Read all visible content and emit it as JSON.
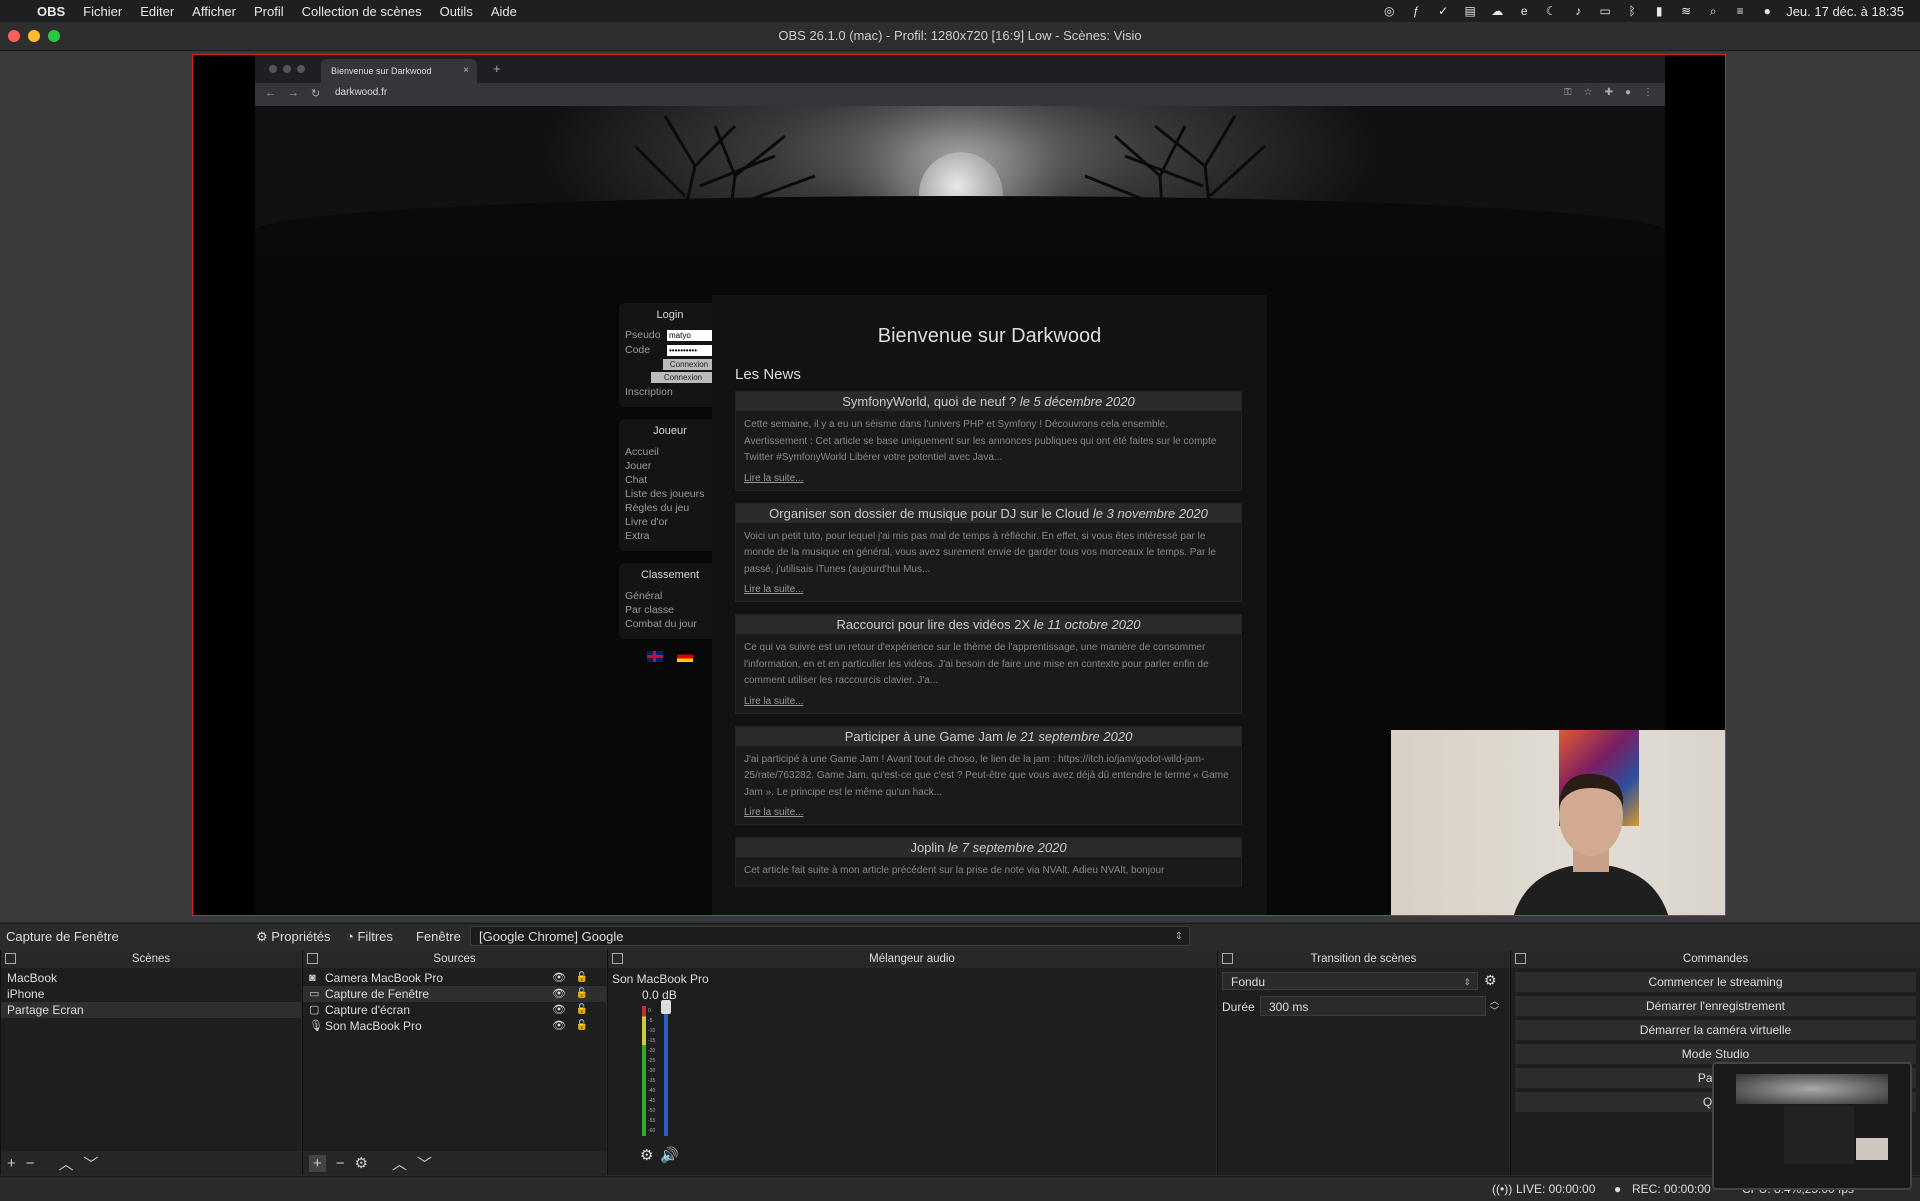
{
  "menubar": {
    "app": "OBS",
    "items": [
      "Fichier",
      "Editer",
      "Afficher",
      "Profil",
      "Collection de scènes",
      "Outils",
      "Aide"
    ],
    "clock": "Jeu. 17 déc. à 18:35",
    "status_icons": [
      "obs-status-icon",
      "text-icon",
      "checkmark-icon",
      "docker-icon",
      "cloud-icon",
      "edge-icon",
      "moon-icon",
      "volume-icon",
      "keyboard-icon",
      "bluetooth-icon",
      "battery-icon",
      "wifi-icon",
      "search-icon",
      "control-center-icon",
      "siri-icon"
    ]
  },
  "window": {
    "title": "OBS 26.1.0 (mac) - Profil: 1280x720 [16:9] Low - Scènes: Visio",
    "light_colors": [
      "#ff5f57",
      "#febc2e",
      "#28c840"
    ]
  },
  "preview": {
    "browser": {
      "tab_title": "Bienvenue sur Darkwood",
      "url": "darkwood.fr"
    },
    "site": {
      "login": {
        "title": "Login",
        "pseudo_label": "Pseudo",
        "pseudo_value": "matyo",
        "code_label": "Code",
        "code_value": "••••••••••",
        "connexion_btn": "Connexion",
        "fb_connexion_btn": "Connexion",
        "inscription": "Inscription"
      },
      "joueur": {
        "title": "Joueur",
        "links": [
          "Accueil",
          "Jouer",
          "Chat",
          "Liste des joueurs",
          "Règles du jeu",
          "Livre d'or",
          "Extra"
        ]
      },
      "classement": {
        "title": "Classement",
        "links": [
          "Général",
          "Par classe",
          "Combat du jour"
        ]
      },
      "welcome": "Bienvenue sur Darkwood",
      "news_heading": "Les News",
      "news": [
        {
          "title": "SymfonyWorld, quoi de neuf ?",
          "date": "le 5 décembre 2020",
          "body": "Cette semaine, il y a eu un séisme dans l'univers PHP et Symfony ! Découvrons cela ensemble. Avertissement : Cet article se base uniquement sur les annonces publiques qui ont été faites sur le compte Twitter #SymfonyWorld Libérer votre potentiel avec Java...",
          "more": "Lire la suite..."
        },
        {
          "title": "Organiser son dossier de musique pour DJ sur le Cloud",
          "date": "le 3 novembre 2020",
          "body": "Voici un petit tuto, pour lequel j'ai mis pas mal de temps à réfléchir. En effet, si vous êtes intéressé par le monde de la musique en général, vous avez surement envie de garder tous vos morceaux le temps. Par le passé, j'utilisais iTunes (aujourd'hui Mus...",
          "more": "Lire la suite..."
        },
        {
          "title": "Raccourci pour lire des vidéos 2X",
          "date": "le 11 octobre 2020",
          "body": "Ce qui va suivre est un retour d'expérience sur le thème de l'apprentissage, une manière de consommer l'information, en et en particulier les vidéos. J'ai besoin de faire une mise en contexte pour parler enfin de comment utiliser les raccourcis clavier. J'a...",
          "more": "Lire la suite..."
        },
        {
          "title": "Participer à une Game Jam",
          "date": "le 21 septembre 2020",
          "body": "J'ai participé à une Game Jam ! Avant tout de choso, le lien de la jam : https://itch.io/jam/godot-wild-jam-25/rate/763282. Game Jam, qu'est-ce que c'est ? Peut-être que vous avez déjà dû entendre le terme « Game Jam ». Le principe est le même qu'un hack...",
          "more": "Lire la suite..."
        },
        {
          "title": "Joplin",
          "date": "le 7 septembre 2020",
          "body": "Cet article fait suite à mon article précédent sur la prise de note via NVAlt. Adieu NVAlt, bonjour",
          "more": ""
        }
      ]
    }
  },
  "sourcebar": {
    "selected_source": "Capture de Fenêtre",
    "properties": "Propriétés",
    "filters": "Filtres",
    "window_label": "Fenêtre",
    "window_value": "[Google Chrome] Google"
  },
  "docks": {
    "scenes": {
      "title": "Scènes",
      "items": [
        "MacBook",
        "iPhone",
        "Partage Ecran"
      ],
      "selected": "Partage Ecran"
    },
    "sources": {
      "title": "Sources",
      "items": [
        {
          "name": "Camera MacBook Pro",
          "icon": "camera-icon"
        },
        {
          "name": "Capture de Fenêtre",
          "icon": "window-icon"
        },
        {
          "name": "Capture d'écran",
          "icon": "monitor-icon"
        },
        {
          "name": "Son MacBook Pro",
          "icon": "microphone-icon"
        }
      ],
      "selected": "Capture de Fenêtre"
    },
    "mixer": {
      "title": "Mélangeur audio",
      "device": "Son MacBook Pro",
      "db": "0.0 dB",
      "meter_ticks": [
        "0",
        "-5",
        "-10",
        "-15",
        "-20",
        "-25",
        "-30",
        "-35",
        "-40",
        "-45",
        "-50",
        "-55",
        "-60"
      ]
    },
    "transitions": {
      "title": "Transition de scènes",
      "type": "Fondu",
      "duration_label": "Durée",
      "duration_value": "300 ms"
    },
    "commands": {
      "title": "Commandes",
      "buttons": [
        "Commencer le streaming",
        "Démarrer l'enregistrement",
        "Démarrer la caméra virtuelle",
        "Mode Studio",
        "Param",
        "Quitt"
      ]
    }
  },
  "statusbar": {
    "live": "LIVE: 00:00:00",
    "rec": "REC: 00:00:00",
    "cpu": "CPU: 8.4%,25.00 fps"
  }
}
